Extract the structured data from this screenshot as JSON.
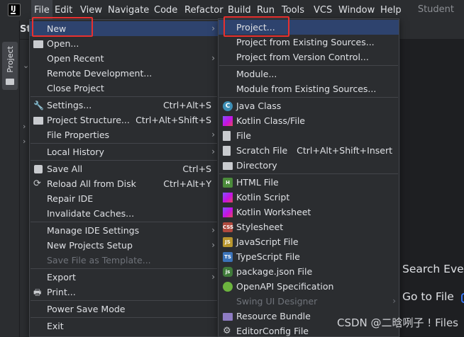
{
  "menubar": {
    "items": [
      "File",
      "Edit",
      "View",
      "Navigate",
      "Code",
      "Refactor",
      "Build",
      "Run",
      "Tools",
      "VCS",
      "Window",
      "Help"
    ],
    "right_text": "Student",
    "logo_text": "IJ"
  },
  "toolbar": {
    "project_label": "St"
  },
  "left_strip": {
    "tab_label": "Project"
  },
  "file_menu": {
    "items": [
      {
        "label": "New",
        "shortcut": "",
        "submenu": true,
        "icon": ""
      },
      {
        "label": "Open...",
        "shortcut": "",
        "submenu": false,
        "icon": "folder-icon"
      },
      {
        "label": "Open Recent",
        "shortcut": "",
        "submenu": true,
        "icon": ""
      },
      {
        "label": "Remote Development...",
        "shortcut": "",
        "submenu": false,
        "icon": ""
      },
      {
        "label": "Close Project",
        "shortcut": "",
        "submenu": false,
        "icon": ""
      },
      {
        "label": "Settings...",
        "shortcut": "Ctrl+Alt+S",
        "submenu": false,
        "icon": "wrench-icon"
      },
      {
        "label": "Project Structure...",
        "shortcut": "Ctrl+Alt+Shift+S",
        "submenu": false,
        "icon": "project-structure-icon"
      },
      {
        "label": "File Properties",
        "shortcut": "",
        "submenu": true,
        "icon": ""
      },
      {
        "label": "Local History",
        "shortcut": "",
        "submenu": true,
        "icon": ""
      },
      {
        "label": "Save All",
        "shortcut": "Ctrl+S",
        "submenu": false,
        "icon": "save-icon"
      },
      {
        "label": "Reload All from Disk",
        "shortcut": "Ctrl+Alt+Y",
        "submenu": false,
        "icon": "reload-icon"
      },
      {
        "label": "Repair IDE",
        "shortcut": "",
        "submenu": false,
        "icon": ""
      },
      {
        "label": "Invalidate Caches...",
        "shortcut": "",
        "submenu": false,
        "icon": ""
      },
      {
        "label": "Manage IDE Settings",
        "shortcut": "",
        "submenu": true,
        "icon": ""
      },
      {
        "label": "New Projects Setup",
        "shortcut": "",
        "submenu": true,
        "icon": ""
      },
      {
        "label": "Save File as Template...",
        "shortcut": "",
        "submenu": false,
        "icon": "",
        "disabled": true
      },
      {
        "label": "Export",
        "shortcut": "",
        "submenu": true,
        "icon": ""
      },
      {
        "label": "Print...",
        "shortcut": "",
        "submenu": false,
        "icon": "print-icon"
      },
      {
        "label": "Power Save Mode",
        "shortcut": "",
        "submenu": false,
        "icon": ""
      },
      {
        "label": "Exit",
        "shortcut": "",
        "submenu": false,
        "icon": ""
      }
    ]
  },
  "new_menu": {
    "items": [
      {
        "label": "Project...",
        "shortcut": "",
        "icon": ""
      },
      {
        "label": "Project from Existing Sources...",
        "shortcut": "",
        "icon": ""
      },
      {
        "label": "Project from Version Control...",
        "shortcut": "",
        "icon": ""
      },
      {
        "label": "Module...",
        "shortcut": "",
        "icon": ""
      },
      {
        "label": "Module from Existing Sources...",
        "shortcut": "",
        "icon": ""
      },
      {
        "label": "Java Class",
        "shortcut": "",
        "icon": "java-class-icon"
      },
      {
        "label": "Kotlin Class/File",
        "shortcut": "",
        "icon": "kotlin-icon"
      },
      {
        "label": "File",
        "shortcut": "",
        "icon": "file-icon"
      },
      {
        "label": "Scratch File",
        "shortcut": "Ctrl+Alt+Shift+Insert",
        "icon": "scratch-file-icon"
      },
      {
        "label": "Directory",
        "shortcut": "",
        "icon": "directory-icon"
      },
      {
        "label": "HTML File",
        "shortcut": "",
        "icon": "html-icon"
      },
      {
        "label": "Kotlin Script",
        "shortcut": "",
        "icon": "kotlin-script-icon"
      },
      {
        "label": "Kotlin Worksheet",
        "shortcut": "",
        "icon": "kotlin-worksheet-icon"
      },
      {
        "label": "Stylesheet",
        "shortcut": "",
        "icon": "css-icon"
      },
      {
        "label": "JavaScript File",
        "shortcut": "",
        "icon": "javascript-icon"
      },
      {
        "label": "TypeScript File",
        "shortcut": "",
        "icon": "typescript-icon"
      },
      {
        "label": "package.json File",
        "shortcut": "",
        "icon": "nodejs-icon"
      },
      {
        "label": "OpenAPI Specification",
        "shortcut": "",
        "icon": "openapi-icon"
      },
      {
        "label": "Swing UI Designer",
        "shortcut": "",
        "icon": "",
        "disabled": true,
        "submenu": true
      },
      {
        "label": "Resource Bundle",
        "shortcut": "",
        "icon": "resource-bundle-icon"
      },
      {
        "label": "EditorConfig File",
        "shortcut": "",
        "icon": "gear-icon"
      }
    ]
  },
  "editor_hints": {
    "search": "Search Ever",
    "goto": "Go to File"
  },
  "watermark": "CSDN @二晗咧子 ! Files",
  "colors": {
    "highlight": "#2e436e",
    "annotation_red": "#e8302f",
    "background": "#2b2d30"
  }
}
